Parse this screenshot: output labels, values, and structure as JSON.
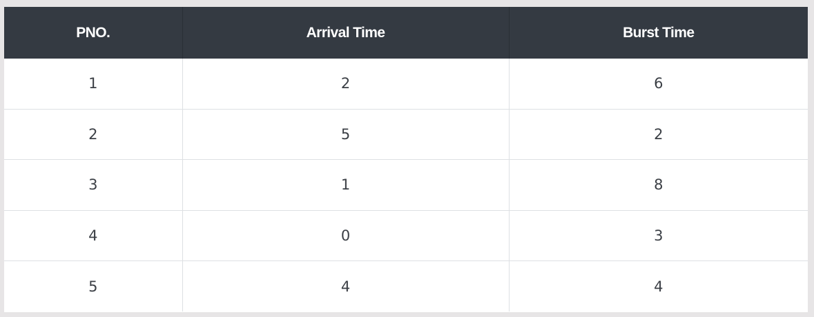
{
  "table": {
    "headers": [
      "PNO.",
      "Arrival Time",
      "Burst Time"
    ],
    "rows": [
      [
        "1",
        "2",
        "6"
      ],
      [
        "2",
        "5",
        "2"
      ],
      [
        "3",
        "1",
        "8"
      ],
      [
        "4",
        "0",
        "3"
      ],
      [
        "5",
        "4",
        "4"
      ]
    ]
  }
}
